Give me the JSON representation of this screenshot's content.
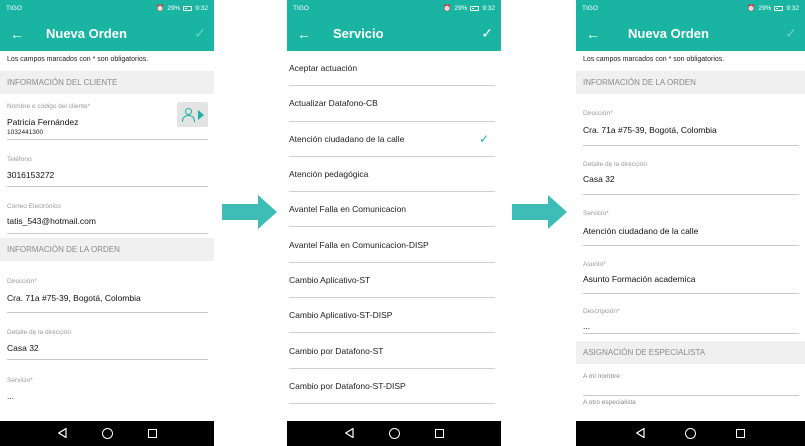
{
  "status": {
    "carrier": "TIGO",
    "battery": "29%",
    "time": "9:32"
  },
  "screen1": {
    "title": "Nueva Orden",
    "note": "Los campos marcados con * son obligatorios.",
    "section_client": "INFORMACIÓN DEL CLIENTE",
    "client_label": "Nombre o código del cliente*",
    "client_name": "Patricia Fernández",
    "client_code": "1032441300",
    "phone_label": "Teléfono",
    "phone_value": "3016153272",
    "email_label": "Correo Electrónico",
    "email_value": "tatis_543@hotmail.com",
    "section_order": "INFORMACIÓN DE LA ORDEN",
    "address_label": "Dirección*",
    "address_value": "Cra. 71a #75-39, Bogotá, Colombia",
    "detail_label": "Detalle de la dirección",
    "detail_value": "Casa 32",
    "service_label": "Servicio*",
    "service_value": "..."
  },
  "screen2": {
    "title": "Servicio",
    "items": [
      "Aceptar actuación",
      "Actualizar Datafono-CB",
      "Atención ciudadano de la calle",
      "Atención pedagógica",
      "Avantel Falla en Comunicacion",
      "Avantel Falla en Comunicacion-DISP",
      "Cambio Aplicativo-ST",
      "Cambio Aplicativo-ST-DISP",
      "Cambio por Datafono-ST",
      "Cambio por Datafono-ST-DISP"
    ],
    "selected_index": 2
  },
  "screen3": {
    "title": "Nueva Orden",
    "note": "Los campos marcados con * son obligatorios.",
    "section_order": "INFORMACIÓN DE LA ORDEN",
    "address_label": "Dirección*",
    "address_value": "Cra. 71a #75-39, Bogotá, Colombia",
    "detail_label": "Detalle de la dirección",
    "detail_value": "Casa 32",
    "service_label": "Servicio*",
    "service_value": "Atención ciudadano de la calle",
    "subject_label": "Asunto*",
    "subject_value": "Asunto Formación academica",
    "description_label": "Descripción*",
    "description_value": "...",
    "section_specialist": "ASIGNACIÓN DE ESPECIALISTA",
    "me_label": "A mí nombre",
    "other_label": "A otro especialista"
  },
  "colors": {
    "accent": "#1ab5a2",
    "arrow": "#3dbdb5"
  }
}
